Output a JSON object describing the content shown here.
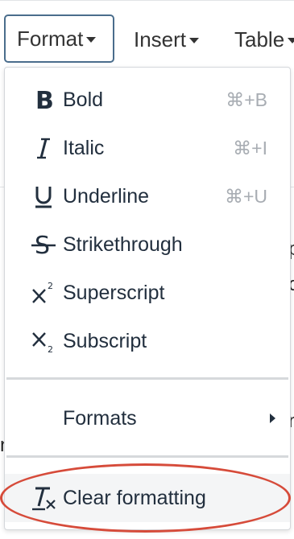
{
  "menubar": {
    "items": [
      {
        "label": "Format"
      },
      {
        "label": "Insert"
      },
      {
        "label": "Table"
      }
    ]
  },
  "background_fragments": [
    "p",
    "o",
    "n",
    "n"
  ],
  "format_menu": {
    "items": [
      {
        "label": "Bold",
        "shortcut": "⌘+B",
        "icon": "bold-icon",
        "glyph": "B"
      },
      {
        "label": "Italic",
        "shortcut": "⌘+I",
        "icon": "italic-icon",
        "glyph": "I"
      },
      {
        "label": "Underline",
        "shortcut": "⌘+U",
        "icon": "underline-icon",
        "glyph": "U"
      },
      {
        "label": "Strikethrough",
        "shortcut": "",
        "icon": "strikethrough-icon",
        "glyph": "S"
      },
      {
        "label": "Superscript",
        "shortcut": "",
        "icon": "superscript-icon",
        "glyph": "x²"
      },
      {
        "label": "Subscript",
        "shortcut": "",
        "icon": "subscript-icon",
        "glyph": "x₂"
      }
    ],
    "formats_label": "Formats",
    "clear_formatting_label": "Clear formatting",
    "clear_formatting_glyph": "Tx"
  },
  "colors": {
    "menubar_active_border": "#4a6d8c",
    "annotation": "#d64b3a",
    "menu_text": "#222f3e",
    "shortcut_text": "#a8adb3"
  }
}
